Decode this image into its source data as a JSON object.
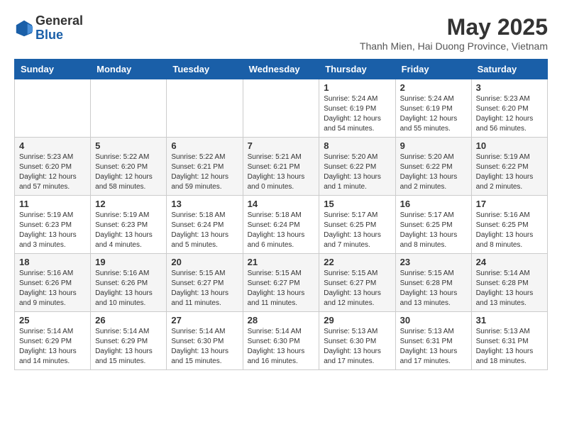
{
  "logo": {
    "general": "General",
    "blue": "Blue"
  },
  "title": {
    "month_year": "May 2025",
    "location": "Thanh Mien, Hai Duong Province, Vietnam"
  },
  "days_of_week": [
    "Sunday",
    "Monday",
    "Tuesday",
    "Wednesday",
    "Thursday",
    "Friday",
    "Saturday"
  ],
  "weeks": [
    [
      {
        "day": "",
        "info": ""
      },
      {
        "day": "",
        "info": ""
      },
      {
        "day": "",
        "info": ""
      },
      {
        "day": "",
        "info": ""
      },
      {
        "day": "1",
        "info": "Sunrise: 5:24 AM\nSunset: 6:19 PM\nDaylight: 12 hours\nand 54 minutes."
      },
      {
        "day": "2",
        "info": "Sunrise: 5:24 AM\nSunset: 6:19 PM\nDaylight: 12 hours\nand 55 minutes."
      },
      {
        "day": "3",
        "info": "Sunrise: 5:23 AM\nSunset: 6:20 PM\nDaylight: 12 hours\nand 56 minutes."
      }
    ],
    [
      {
        "day": "4",
        "info": "Sunrise: 5:23 AM\nSunset: 6:20 PM\nDaylight: 12 hours\nand 57 minutes."
      },
      {
        "day": "5",
        "info": "Sunrise: 5:22 AM\nSunset: 6:20 PM\nDaylight: 12 hours\nand 58 minutes."
      },
      {
        "day": "6",
        "info": "Sunrise: 5:22 AM\nSunset: 6:21 PM\nDaylight: 12 hours\nand 59 minutes."
      },
      {
        "day": "7",
        "info": "Sunrise: 5:21 AM\nSunset: 6:21 PM\nDaylight: 13 hours\nand 0 minutes."
      },
      {
        "day": "8",
        "info": "Sunrise: 5:20 AM\nSunset: 6:22 PM\nDaylight: 13 hours\nand 1 minute."
      },
      {
        "day": "9",
        "info": "Sunrise: 5:20 AM\nSunset: 6:22 PM\nDaylight: 13 hours\nand 2 minutes."
      },
      {
        "day": "10",
        "info": "Sunrise: 5:19 AM\nSunset: 6:22 PM\nDaylight: 13 hours\nand 2 minutes."
      }
    ],
    [
      {
        "day": "11",
        "info": "Sunrise: 5:19 AM\nSunset: 6:23 PM\nDaylight: 13 hours\nand 3 minutes."
      },
      {
        "day": "12",
        "info": "Sunrise: 5:19 AM\nSunset: 6:23 PM\nDaylight: 13 hours\nand 4 minutes."
      },
      {
        "day": "13",
        "info": "Sunrise: 5:18 AM\nSunset: 6:24 PM\nDaylight: 13 hours\nand 5 minutes."
      },
      {
        "day": "14",
        "info": "Sunrise: 5:18 AM\nSunset: 6:24 PM\nDaylight: 13 hours\nand 6 minutes."
      },
      {
        "day": "15",
        "info": "Sunrise: 5:17 AM\nSunset: 6:25 PM\nDaylight: 13 hours\nand 7 minutes."
      },
      {
        "day": "16",
        "info": "Sunrise: 5:17 AM\nSunset: 6:25 PM\nDaylight: 13 hours\nand 8 minutes."
      },
      {
        "day": "17",
        "info": "Sunrise: 5:16 AM\nSunset: 6:25 PM\nDaylight: 13 hours\nand 8 minutes."
      }
    ],
    [
      {
        "day": "18",
        "info": "Sunrise: 5:16 AM\nSunset: 6:26 PM\nDaylight: 13 hours\nand 9 minutes."
      },
      {
        "day": "19",
        "info": "Sunrise: 5:16 AM\nSunset: 6:26 PM\nDaylight: 13 hours\nand 10 minutes."
      },
      {
        "day": "20",
        "info": "Sunrise: 5:15 AM\nSunset: 6:27 PM\nDaylight: 13 hours\nand 11 minutes."
      },
      {
        "day": "21",
        "info": "Sunrise: 5:15 AM\nSunset: 6:27 PM\nDaylight: 13 hours\nand 11 minutes."
      },
      {
        "day": "22",
        "info": "Sunrise: 5:15 AM\nSunset: 6:27 PM\nDaylight: 13 hours\nand 12 minutes."
      },
      {
        "day": "23",
        "info": "Sunrise: 5:15 AM\nSunset: 6:28 PM\nDaylight: 13 hours\nand 13 minutes."
      },
      {
        "day": "24",
        "info": "Sunrise: 5:14 AM\nSunset: 6:28 PM\nDaylight: 13 hours\nand 13 minutes."
      }
    ],
    [
      {
        "day": "25",
        "info": "Sunrise: 5:14 AM\nSunset: 6:29 PM\nDaylight: 13 hours\nand 14 minutes."
      },
      {
        "day": "26",
        "info": "Sunrise: 5:14 AM\nSunset: 6:29 PM\nDaylight: 13 hours\nand 15 minutes."
      },
      {
        "day": "27",
        "info": "Sunrise: 5:14 AM\nSunset: 6:30 PM\nDaylight: 13 hours\nand 15 minutes."
      },
      {
        "day": "28",
        "info": "Sunrise: 5:14 AM\nSunset: 6:30 PM\nDaylight: 13 hours\nand 16 minutes."
      },
      {
        "day": "29",
        "info": "Sunrise: 5:13 AM\nSunset: 6:30 PM\nDaylight: 13 hours\nand 17 minutes."
      },
      {
        "day": "30",
        "info": "Sunrise: 5:13 AM\nSunset: 6:31 PM\nDaylight: 13 hours\nand 17 minutes."
      },
      {
        "day": "31",
        "info": "Sunrise: 5:13 AM\nSunset: 6:31 PM\nDaylight: 13 hours\nand 18 minutes."
      }
    ]
  ]
}
